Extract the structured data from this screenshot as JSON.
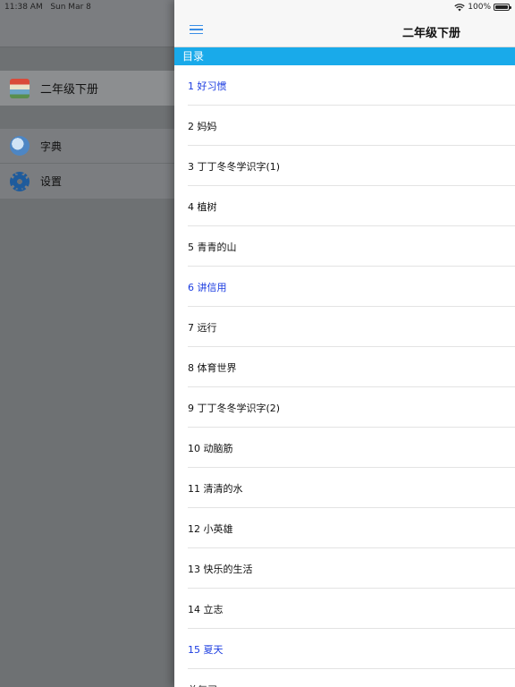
{
  "status_bar": {
    "time": "11:38 AM",
    "date": "Sun Mar 8",
    "battery": "100%",
    "battery_level": 1.0
  },
  "sidebar": {
    "book": {
      "label": "二年级下册",
      "icon": "book-cover-icon"
    },
    "items": [
      {
        "label": "字典",
        "icon": "dictionary-icon"
      },
      {
        "label": "设置",
        "icon": "gear-icon"
      }
    ]
  },
  "panel": {
    "title": "二年级下册",
    "menu_icon": "hamburger-menu-icon",
    "section": "目录",
    "accent_color": "#19aaea",
    "highlight_color": "#1a3be0",
    "lessons": [
      {
        "label": "1 好习惯",
        "highlight": true
      },
      {
        "label": "2 妈妈",
        "highlight": false
      },
      {
        "label": "3 丁丁冬冬学识字(1)",
        "highlight": false
      },
      {
        "label": "4 植树",
        "highlight": false
      },
      {
        "label": "5 青青的山",
        "highlight": false
      },
      {
        "label": "6 讲信用",
        "highlight": true
      },
      {
        "label": "7 远行",
        "highlight": false
      },
      {
        "label": "8 体育世界",
        "highlight": false
      },
      {
        "label": "9 丁丁冬冬学识字(2)",
        "highlight": false
      },
      {
        "label": "10 动脑筋",
        "highlight": false
      },
      {
        "label": "11 清清的水",
        "highlight": false
      },
      {
        "label": "12 小英雄",
        "highlight": false
      },
      {
        "label": "13 快乐的生活",
        "highlight": false
      },
      {
        "label": "14 立志",
        "highlight": false
      },
      {
        "label": "15 夏天",
        "highlight": true
      },
      {
        "label": "总复习",
        "highlight": false
      }
    ]
  }
}
